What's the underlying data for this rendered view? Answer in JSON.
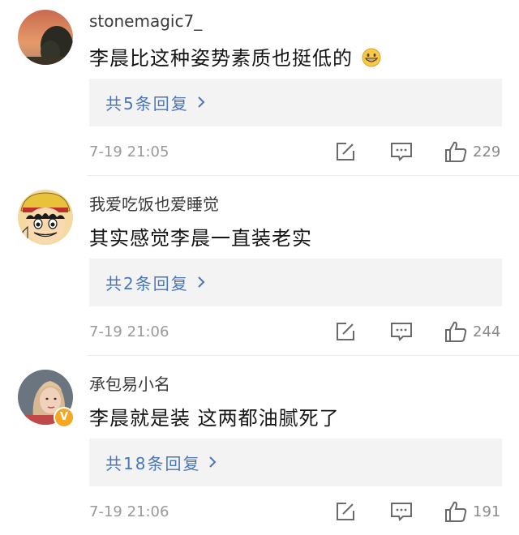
{
  "comments": [
    {
      "username": "stonemagic7_",
      "text": "李晨比这种姿势素质也挺低的",
      "emoji": "grinning-face-icon",
      "replies_label": "共5条回复",
      "timestamp": "7-19 21:05",
      "likes": "229"
    },
    {
      "username": "我爱吃饭也爱睡觉",
      "text": "其实感觉李晨一直装老实",
      "replies_label": "共2条回复",
      "timestamp": "7-19 21:06",
      "likes": "244"
    },
    {
      "username": "承包易小名",
      "text": "李晨就是装 这两都油腻死了",
      "replies_label": "共18条回复",
      "timestamp": "7-19 21:06",
      "likes": "191",
      "badge": "V"
    }
  ],
  "colors": {
    "link": "#4a76b8",
    "badge": "#f5a623",
    "meta": "#9a9a9a"
  }
}
